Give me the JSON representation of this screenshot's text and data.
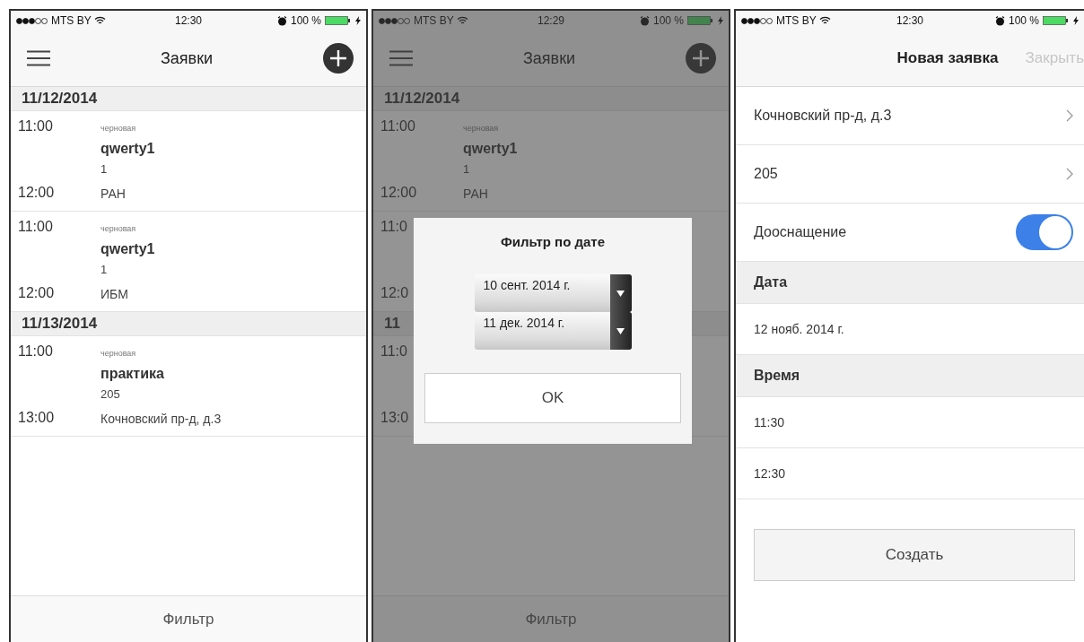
{
  "list_screen": {
    "status": {
      "carrier": "MTS BY",
      "time": "12:30",
      "battery": "100 %"
    },
    "nav": {
      "title": "Заявки"
    },
    "sections": [
      {
        "date": "11/12/2014",
        "items": [
          {
            "start": "11:00",
            "status": "черновая",
            "name": "qwerty1",
            "room": "1",
            "end": "12:00",
            "place": "РАН"
          },
          {
            "start": "11:00",
            "status": "черновая",
            "name": "qwerty1",
            "room": "1",
            "end": "12:00",
            "place": "ИБМ"
          }
        ]
      },
      {
        "date": "11/13/2014",
        "items": [
          {
            "start": "11:00",
            "status": "черновая",
            "name": "практика",
            "room": "205",
            "end": "13:00",
            "place": "Кочновский пр-д, д.3"
          }
        ]
      }
    ],
    "footer": "Фильтр"
  },
  "filter_screen": {
    "status": {
      "carrier": "MTS BY",
      "time": "12:29",
      "battery": "100 %"
    },
    "nav": {
      "title": "Заявки"
    },
    "sections": [
      {
        "date": "11/12/2014",
        "items": [
          {
            "start": "11:00",
            "status": "черновая",
            "name": "qwerty1",
            "room": "1",
            "end": "12:00",
            "place": "РАН"
          },
          {
            "start": "11:0",
            "end": "12:0"
          }
        ]
      },
      {
        "date": "11",
        "items": [
          {
            "start": "11:0",
            "end": "13:0"
          }
        ]
      }
    ],
    "footer": "Фильтр",
    "modal": {
      "title": "Фильтр по дате",
      "dates": [
        "10 сент. 2014 г.",
        "11 дек. 2014 г."
      ],
      "ok": "OK"
    }
  },
  "new_request_screen": {
    "status": {
      "carrier": "MTS BY",
      "time": "12:30",
      "battery": "100 %"
    },
    "nav": {
      "title": "Новая заявка",
      "close": {
        "label": "Закрыть",
        "disabled": true
      }
    },
    "rows": [
      {
        "kind": "link",
        "label": "Кочновский пр-д, д.3"
      },
      {
        "kind": "link",
        "label": "205"
      },
      {
        "kind": "toggle",
        "label": "Дооснащение",
        "on": true
      },
      {
        "kind": "header",
        "label": "Дата"
      },
      {
        "kind": "value",
        "label": "12 нояб. 2014 г."
      },
      {
        "kind": "header",
        "label": "Время"
      },
      {
        "kind": "value",
        "label": "11:30"
      },
      {
        "kind": "value",
        "label": "12:30"
      }
    ],
    "button": "Создать"
  }
}
